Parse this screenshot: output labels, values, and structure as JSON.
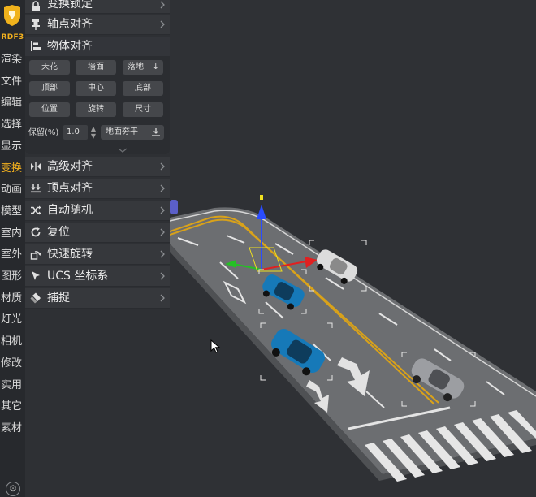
{
  "rail": {
    "logo": "shield-logo",
    "label": "RDF3",
    "items": [
      "渲染",
      "文件",
      "编辑",
      "选择",
      "显示",
      "变换",
      "动画",
      "模型",
      "室内",
      "室外",
      "图形",
      "材质",
      "灯光",
      "相机",
      "修改",
      "实用",
      "其它",
      "素材"
    ],
    "active_item": "变换",
    "settings_icon": "gear-icon"
  },
  "panel": {
    "sections_top": [
      {
        "title": "变换锁定",
        "icon": "lock-icon"
      },
      {
        "title": "轴点对齐",
        "icon": "pin-icon"
      },
      {
        "title": "物体对齐",
        "icon": "align-icon"
      }
    ],
    "object_align": {
      "buttons_row1": [
        "天花",
        "墙面",
        "落地"
      ],
      "buttons_row2": [
        "顶部",
        "中心",
        "底部"
      ],
      "buttons_row3": [
        "位置",
        "旋转",
        "尺寸"
      ],
      "keep_label": "保留(%)",
      "keep_value": "1.0",
      "ground_button": "地面夯平"
    },
    "sections_bottom": [
      {
        "title": "高级对齐",
        "icon": "mirror-align-icon"
      },
      {
        "title": "顶点对齐",
        "icon": "vertex-align-icon"
      },
      {
        "title": "自动随机",
        "icon": "shuffle-icon"
      },
      {
        "title": "复位",
        "icon": "reset-icon"
      },
      {
        "title": "快速旋转",
        "icon": "rotate-icon"
      },
      {
        "title": "UCS 坐标系",
        "icon": "cursor-axis-icon"
      },
      {
        "title": "捕捉",
        "icon": "magnet-icon"
      }
    ]
  },
  "colors": {
    "accent": "#f2b01e",
    "panel_bg": "#2e3034",
    "road": "#6c6e71",
    "lane_yellow": "#d9a21a",
    "gizmo_z": "#2a4cff",
    "gizmo_x": "#e02020",
    "gizmo_y": "#25c025",
    "car_blue": "#1679b8"
  }
}
